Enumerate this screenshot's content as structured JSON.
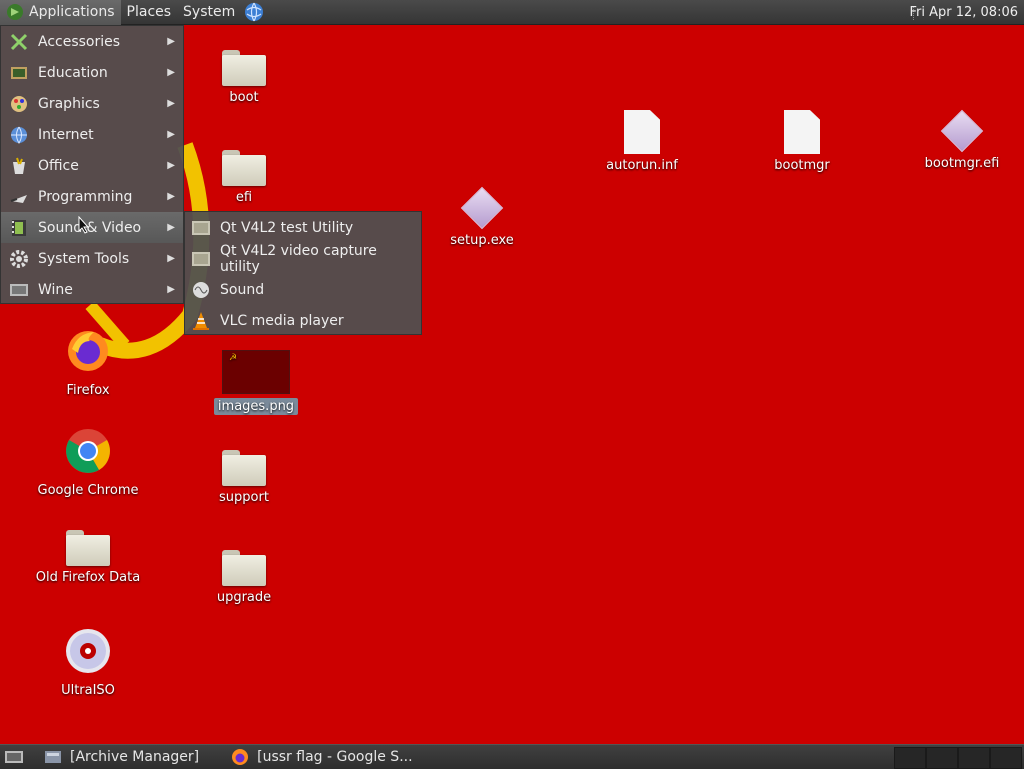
{
  "top_panel": {
    "menus": [
      "Applications",
      "Places",
      "System"
    ],
    "clock": "Fri Apr 12, 08:06"
  },
  "app_menu": {
    "items": [
      {
        "label": "Accessories",
        "icon": "accessories-icon"
      },
      {
        "label": "Education",
        "icon": "education-icon"
      },
      {
        "label": "Graphics",
        "icon": "graphics-icon"
      },
      {
        "label": "Internet",
        "icon": "internet-icon"
      },
      {
        "label": "Office",
        "icon": "office-icon"
      },
      {
        "label": "Programming",
        "icon": "programming-icon"
      },
      {
        "label": "Sound & Video",
        "icon": "sound-video-icon"
      },
      {
        "label": "System Tools",
        "icon": "system-tools-icon"
      },
      {
        "label": "Wine",
        "icon": "wine-icon"
      }
    ]
  },
  "sub_menu": {
    "items": [
      {
        "label": "Qt V4L2 test Utility",
        "icon": "qt-v4l2-icon"
      },
      {
        "label": "Qt V4L2 video capture utility",
        "icon": "qt-v4l2-capture-icon"
      },
      {
        "label": "Sound",
        "icon": "sound-icon"
      },
      {
        "label": "VLC media player",
        "icon": "vlc-cone-icon"
      }
    ]
  },
  "desktop": {
    "icons": [
      {
        "label": "boot",
        "type": "folder"
      },
      {
        "label": "efi",
        "type": "folder"
      },
      {
        "label": "images.png",
        "type": "image"
      },
      {
        "label": "support",
        "type": "folder"
      },
      {
        "label": "upgrade",
        "type": "folder"
      },
      {
        "label": "setup.exe",
        "type": "exe"
      },
      {
        "label": "autorun.inf",
        "type": "document"
      },
      {
        "label": "bootmgr",
        "type": "document"
      },
      {
        "label": "bootmgr.efi",
        "type": "exe"
      },
      {
        "label": "Firefox",
        "type": "launcher"
      },
      {
        "label": "Google Chrome",
        "type": "launcher"
      },
      {
        "label": "Old Firefox Data",
        "type": "folder"
      },
      {
        "label": "UltraISO",
        "type": "launcher"
      }
    ]
  },
  "taskbar": {
    "tasks": [
      "[Archive Manager]",
      "[ussr flag - Google S..."
    ]
  },
  "colors": {
    "desktop_bg": "#cc0000",
    "panel_bg": "#3c3c3c",
    "menu_bg": "#505050",
    "selection": "#7a8a9a"
  }
}
